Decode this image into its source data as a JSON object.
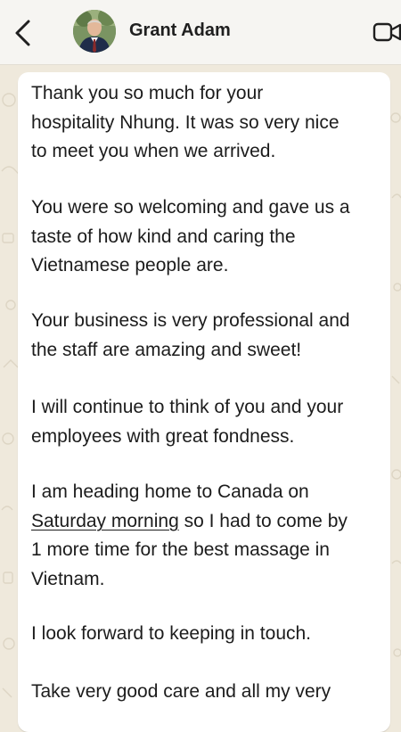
{
  "header": {
    "contact_name": "Grant Adam",
    "back_icon": "chevron-left-icon",
    "video_icon": "video-camera-icon"
  },
  "colors": {
    "chat_background": "#efe9dc",
    "bubble": "#ffffff",
    "header": "#f6f5f2",
    "text": "#1c1c1c"
  },
  "message": {
    "paragraphs": [
      {
        "lines": [
          "Thank you so much for your",
          "hospitality Nhung. It was so very nice",
          "to meet you when we arrived."
        ]
      },
      {
        "lines": [
          "You were so welcoming and gave us a",
          "taste of how kind and caring the",
          "Vietnamese people are."
        ]
      },
      {
        "lines": [
          "Your business is very professional and",
          "the staff are amazing and sweet!"
        ]
      },
      {
        "lines": [
          "I will continue to think of you and your",
          "employees with great fondness."
        ]
      },
      {
        "lines": [
          "I am heading home to Canada on",
          "so I had to come by",
          "1 more time for the best massage in",
          "Vietnam."
        ],
        "link_text": "Saturday morning"
      },
      {
        "lines": [
          "I look forward to keeping in touch."
        ]
      },
      {
        "lines": [
          "Take very good care and all my very"
        ]
      }
    ]
  }
}
